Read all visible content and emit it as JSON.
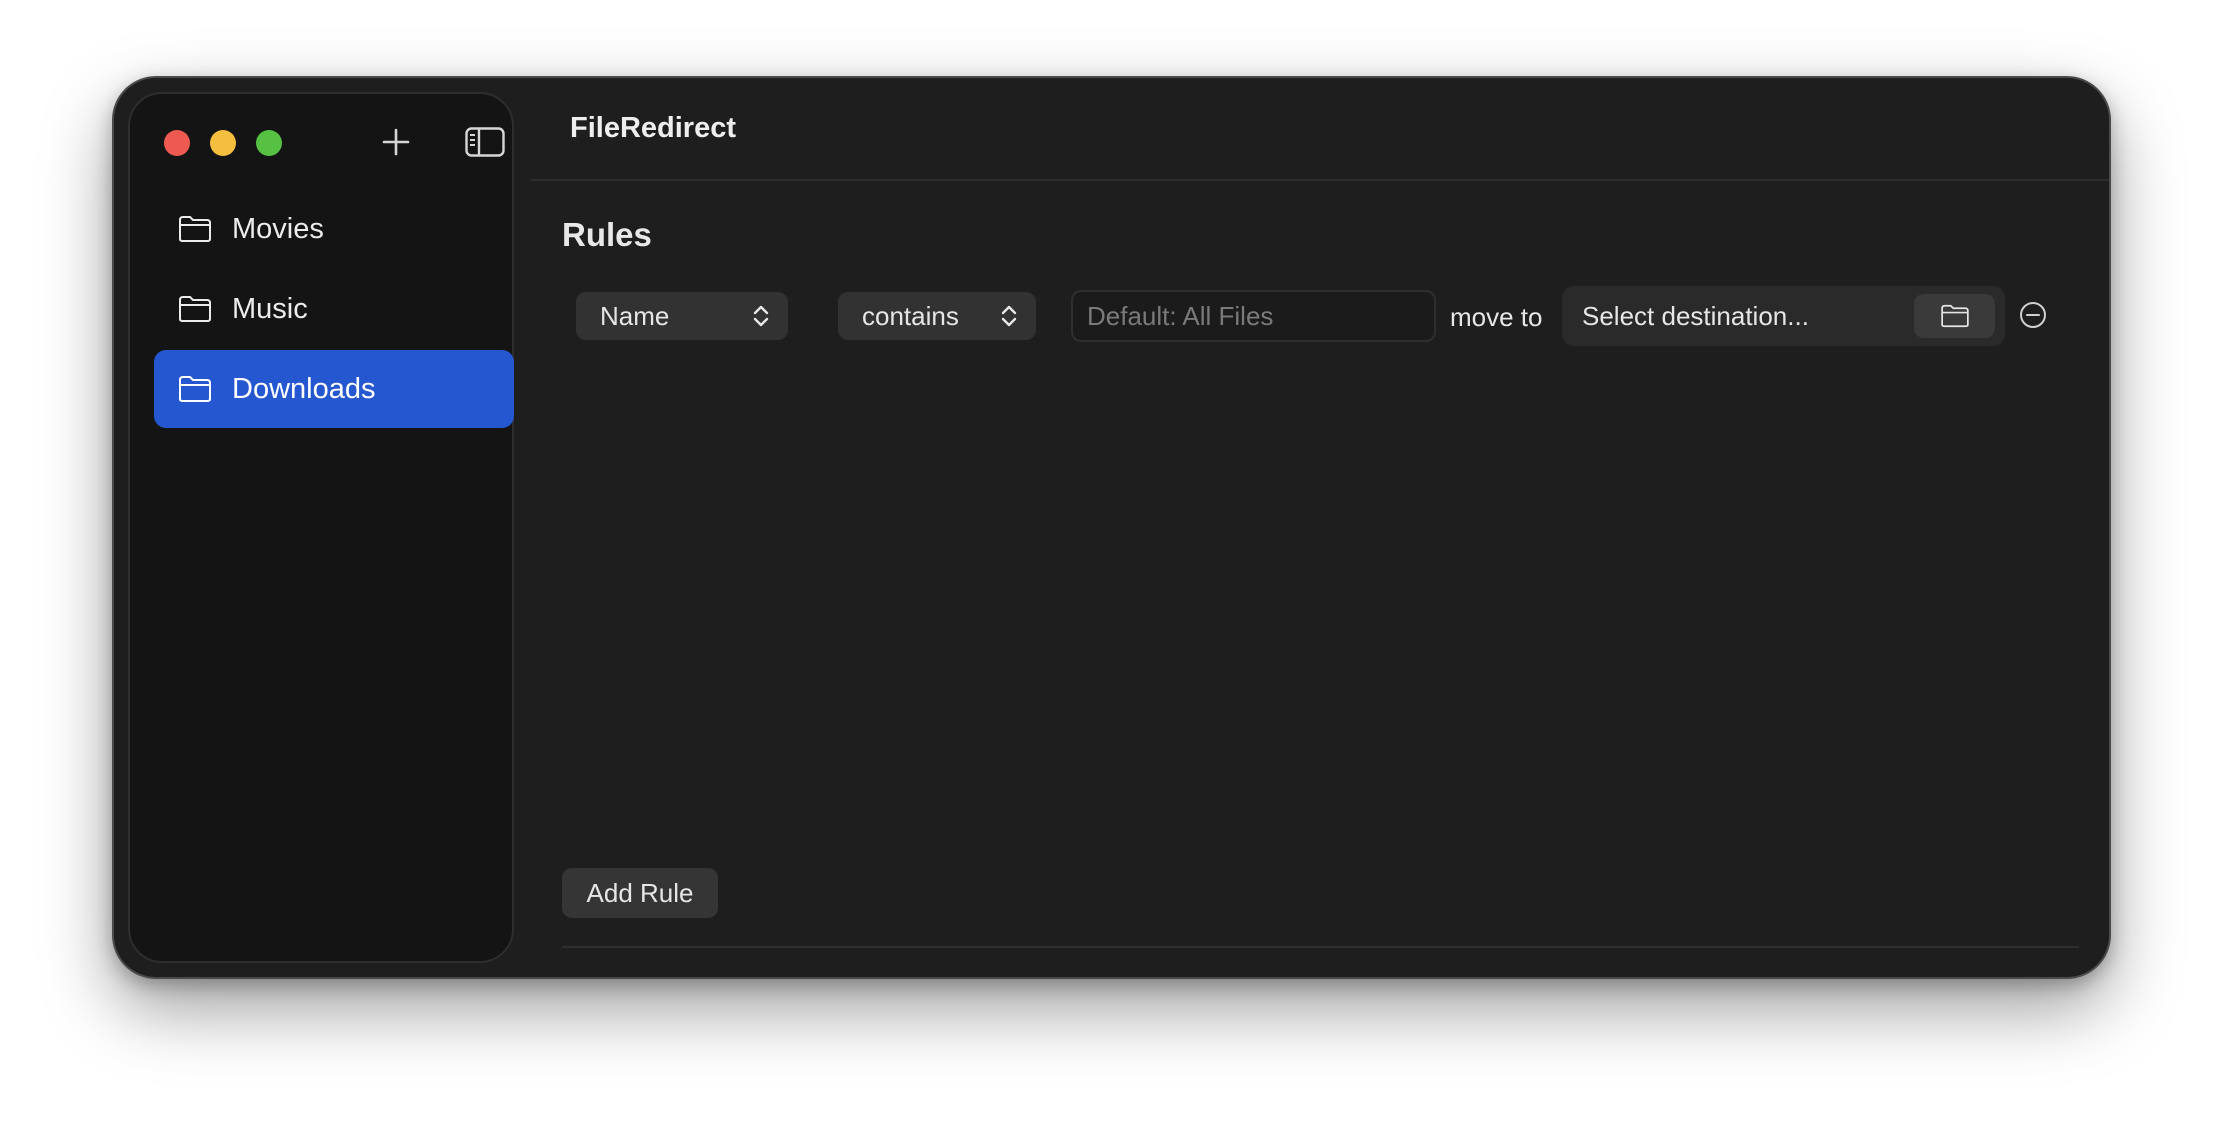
{
  "window": {
    "title": "FileRedirect"
  },
  "sidebar": {
    "items": [
      {
        "label": "Movies",
        "icon": "folder-icon",
        "selected": false
      },
      {
        "label": "Music",
        "icon": "folder-icon",
        "selected": false
      },
      {
        "label": "Downloads",
        "icon": "folder-icon",
        "selected": true
      }
    ],
    "accent_color": "#2557d0"
  },
  "main": {
    "section_title": "Rules",
    "rule": {
      "attribute": "Name",
      "condition": "contains",
      "value": "",
      "value_placeholder": "Default: All Files",
      "action_label": "move to",
      "destination_placeholder": "Select destination..."
    },
    "add_rule_label": "Add Rule"
  },
  "icons": {
    "close": "traffic-light-red",
    "minimize": "traffic-light-yellow",
    "zoom": "traffic-light-green",
    "add": "plus-icon",
    "sidebar_toggle": "sidebar-icon",
    "browse": "folder-icon",
    "remove": "minus-circle-icon"
  }
}
